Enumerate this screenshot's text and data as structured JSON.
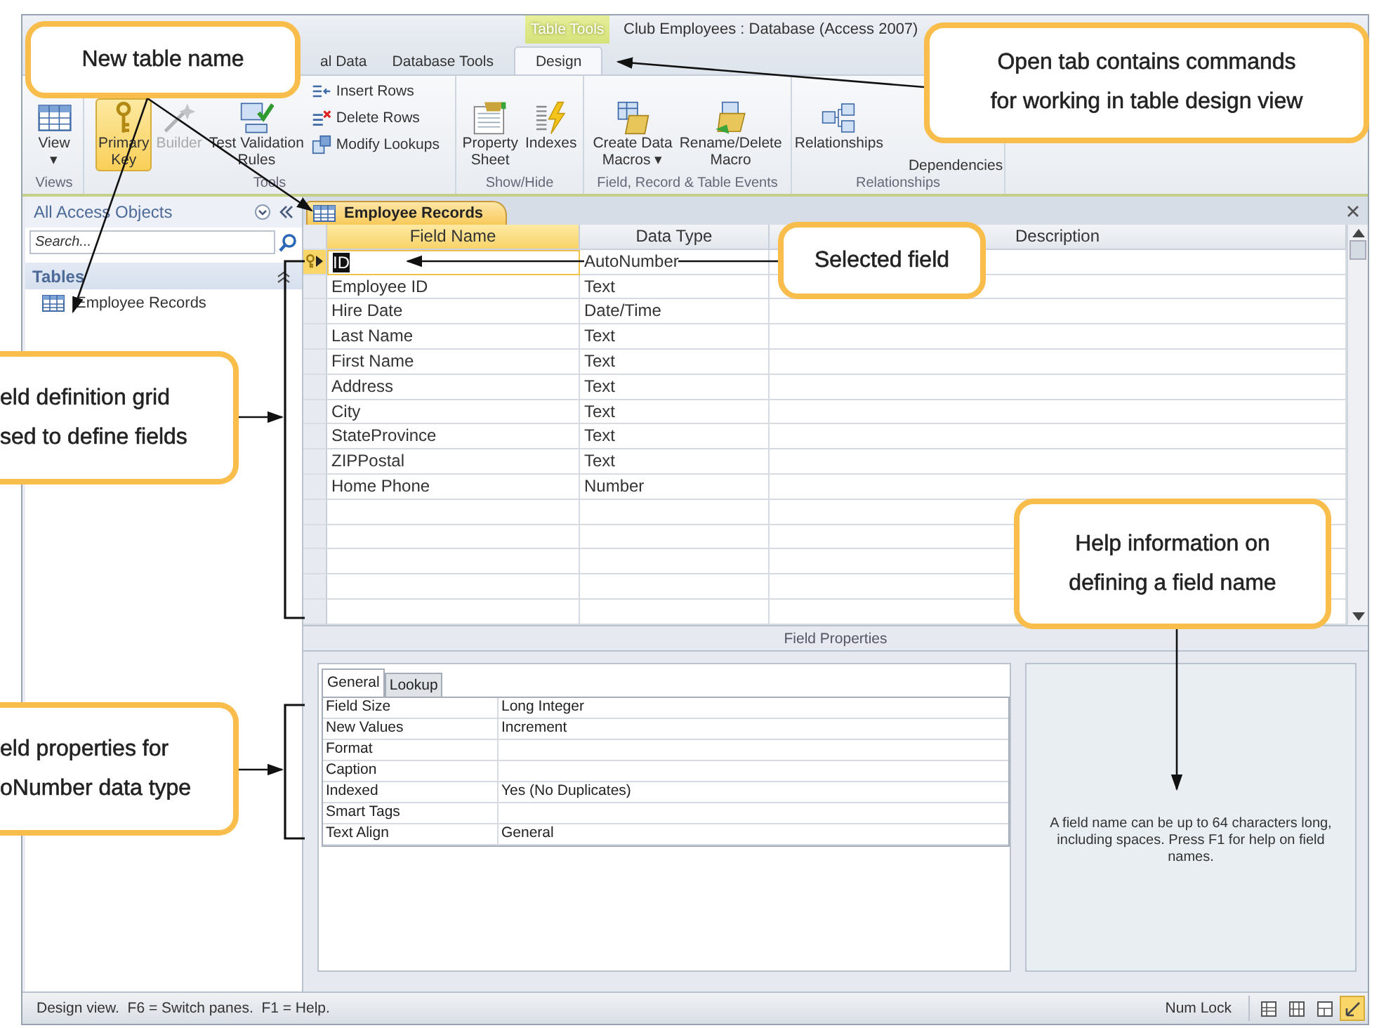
{
  "window": {
    "title": "Club Employees : Database (Access 2007)",
    "context_label": "Table Tools"
  },
  "ribbon_tabs": [
    {
      "label": "al Data",
      "selected": false
    },
    {
      "label": "Database Tools",
      "selected": false
    },
    {
      "label": "Design",
      "selected": true
    }
  ],
  "ribbon_groups": [
    {
      "label": "Views",
      "commands": [
        {
          "kind": "large",
          "lines": [
            "View"
          ],
          "arrow": "▾",
          "selected": false,
          "disabled": false
        }
      ]
    },
    {
      "label": "Tools",
      "commands": [
        {
          "kind": "large",
          "lines": [
            "Primary",
            "Key"
          ],
          "selected": true,
          "disabled": false
        },
        {
          "kind": "large",
          "lines": [
            "Builder"
          ],
          "selected": false,
          "disabled": true
        },
        {
          "kind": "large",
          "lines": [
            "Test Validation",
            "Rules"
          ],
          "selected": false,
          "disabled": false
        },
        {
          "kind": "small",
          "lines": [
            "Insert Rows"
          ],
          "selected": false,
          "disabled": false
        },
        {
          "kind": "small",
          "lines": [
            "Delete Rows"
          ],
          "selected": false,
          "disabled": false
        },
        {
          "kind": "small",
          "lines": [
            "Modify Lookups"
          ],
          "selected": false,
          "disabled": false
        }
      ]
    },
    {
      "label": "Show/Hide",
      "commands": [
        {
          "kind": "large",
          "lines": [
            "Property",
            "Sheet"
          ],
          "selected": false,
          "disabled": false
        },
        {
          "kind": "large",
          "lines": [
            "Indexes"
          ],
          "selected": false,
          "disabled": false
        }
      ]
    },
    {
      "label": "Field, Record & Table Events",
      "commands": [
        {
          "kind": "large",
          "lines": [
            "Create Data",
            "Macros"
          ],
          "arrow": "▾",
          "selected": false,
          "disabled": false
        },
        {
          "kind": "large",
          "lines": [
            "Rename/Delete",
            "Macro"
          ],
          "selected": false,
          "disabled": false
        }
      ]
    },
    {
      "label": "Relationships",
      "commands": [
        {
          "kind": "large",
          "lines": [
            "Relationships"
          ],
          "selected": false,
          "disabled": false
        },
        {
          "kind": "covered",
          "lines": [
            "Dependencies"
          ],
          "selected": false,
          "disabled": false
        }
      ]
    }
  ],
  "nav_pane": {
    "title": "All Access Objects",
    "search": {
      "placeholder": "Search..."
    },
    "groups": [
      {
        "label": "Tables",
        "items": [
          "Employee Records"
        ]
      }
    ]
  },
  "document_tabs": [
    {
      "label": "Employee Records",
      "selected": true
    }
  ],
  "grid": {
    "columns": [
      "Field Name",
      "Data Type",
      "Description"
    ],
    "rows": [
      {
        "field_name": "ID",
        "data_type": "AutoNumber",
        "primary_key": true,
        "selected": true
      },
      {
        "field_name": "Employee ID",
        "data_type": "Text",
        "primary_key": false,
        "selected": false
      },
      {
        "field_name": "Hire Date",
        "data_type": "Date/Time",
        "primary_key": false,
        "selected": false
      },
      {
        "field_name": "Last Name",
        "data_type": "Text",
        "primary_key": false,
        "selected": false
      },
      {
        "field_name": "First Name",
        "data_type": "Text",
        "primary_key": false,
        "selected": false
      },
      {
        "field_name": "Address",
        "data_type": "Text",
        "primary_key": false,
        "selected": false
      },
      {
        "field_name": "City",
        "data_type": "Text",
        "primary_key": false,
        "selected": false
      },
      {
        "field_name": "StateProvince",
        "data_type": "Text",
        "primary_key": false,
        "selected": false
      },
      {
        "field_name": "ZIPPostal",
        "data_type": "Text",
        "primary_key": false,
        "selected": false
      },
      {
        "field_name": "Home Phone",
        "data_type": "Number",
        "primary_key": false,
        "selected": false
      }
    ]
  },
  "field_properties": {
    "label": "Field Properties",
    "tabs": [
      {
        "label": "General",
        "selected": true
      },
      {
        "label": "Lookup",
        "selected": false
      }
    ],
    "rows": [
      {
        "property": "Field Size",
        "value": "Long Integer"
      },
      {
        "property": "New Values",
        "value": "Increment"
      },
      {
        "property": "Format"
      },
      {
        "property": "Caption"
      },
      {
        "property": "Indexed",
        "value": "Yes (No Duplicates)"
      },
      {
        "property": "Smart Tags"
      },
      {
        "property": "Text Align",
        "value": "General"
      }
    ],
    "help": "A field name can be up to 64 characters long, including spaces. Press F1 for help on field names."
  },
  "status_bar": {
    "message": "Design view.  F6 = Switch panes.  F1 = Help.",
    "indicator": "Num Lock",
    "view_buttons": [
      {
        "selected": false
      },
      {
        "selected": false
      },
      {
        "selected": false
      },
      {
        "selected": true
      }
    ]
  },
  "callouts": [
    {
      "lines": [
        "New table name"
      ]
    },
    {
      "lines": [
        "Open tab contains commands",
        "for working in table design view"
      ]
    },
    {
      "lines": [
        "Selected field"
      ]
    },
    {
      "lines": [
        "eld definition grid",
        "sed to define fields"
      ]
    },
    {
      "lines": [
        "Help information on",
        "defining a field name"
      ]
    },
    {
      "lines": [
        "eld properties for",
        "oNumber data type"
      ]
    }
  ]
}
